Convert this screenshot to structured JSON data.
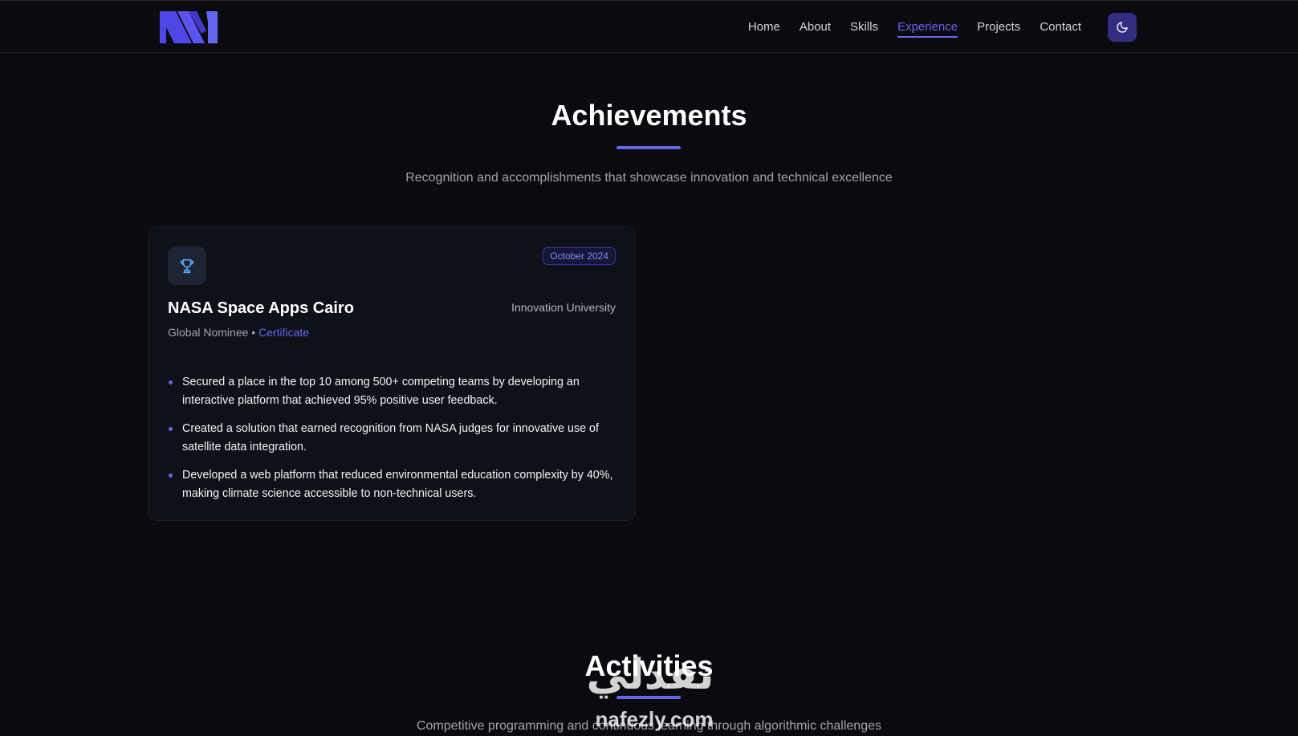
{
  "brand": {
    "logo_icon": "monogram-logo",
    "accent": "#6366f1"
  },
  "nav": {
    "items": [
      {
        "label": "Home",
        "active": false
      },
      {
        "label": "About",
        "active": false
      },
      {
        "label": "Skills",
        "active": false
      },
      {
        "label": "Experience",
        "active": true
      },
      {
        "label": "Projects",
        "active": false
      },
      {
        "label": "Contact",
        "active": false
      }
    ],
    "theme_toggle_icon": "moon-icon"
  },
  "achievements": {
    "title": "Achievements",
    "subtitle": "Recognition and accomplishments that showcase innovation and technical excellence",
    "card": {
      "icon": "trophy-icon",
      "date": "October 2024",
      "title": "NASA Space Apps Cairo",
      "organization": "Innovation University",
      "role": "Global Nominee",
      "separator": "•",
      "certificate_label": "Certificate",
      "bullets": [
        "Secured a place in the top 10 among 500+ competing teams by developing an interactive platform that achieved 95% positive user feedback.",
        "Created a solution that earned recognition from NASA judges for innovative use of satellite data integration.",
        "Developed a web platform that reduced environmental education complexity by 40%, making climate science accessible to non-technical users."
      ]
    }
  },
  "activities": {
    "title": "Activities",
    "subtitle": "Competitive programming and continuous learning through algorithmic challenges"
  },
  "watermark": {
    "arabic": "نفدلي",
    "latin": "nafezly.com"
  }
}
